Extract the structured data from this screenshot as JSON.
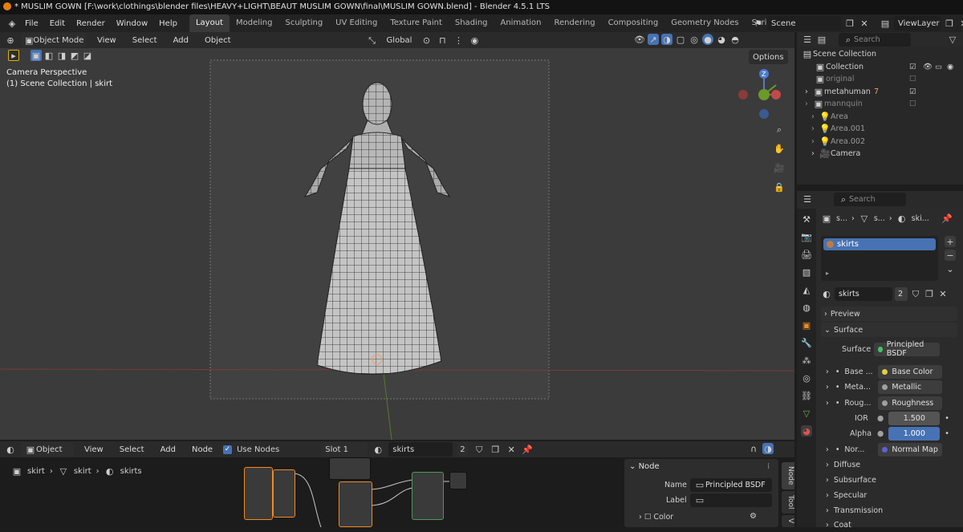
{
  "titlebar": {
    "text": "* MUSLIM GOWN [F:\\work\\clothings\\blender files\\HEAVY+LIGHT\\BEAUT MUSLIM GOWN\\final\\MUSLIM GOWN.blend] - Blender 4.5.1 LTS"
  },
  "menu": [
    "File",
    "Edit",
    "Render",
    "Window",
    "Help"
  ],
  "workspaces": [
    "Layout",
    "Modeling",
    "Sculpting",
    "UV Editing",
    "Texture Paint",
    "Shading",
    "Animation",
    "Rendering",
    "Compositing",
    "Geometry Nodes",
    "Scripting"
  ],
  "scene": {
    "label": "Scene",
    "viewlayer": "ViewLayer"
  },
  "viewport_header": {
    "mode": "Object Mode",
    "menus": [
      "View",
      "Select",
      "Add",
      "Object"
    ],
    "orientation": "Global",
    "options": "Options"
  },
  "viewport": {
    "overlay_line1": "Camera Perspective",
    "overlay_line2": "(1) Scene Collection | skirt"
  },
  "outliner": {
    "search_placeholder": "Search",
    "root": "Scene Collection",
    "items": [
      "Collection",
      "original",
      "metahuman",
      "mannquin",
      "Area",
      "Area.001",
      "Area.002",
      "Camera"
    ],
    "badge": "7"
  },
  "properties": {
    "search_placeholder": "Search",
    "breadcrumb": [
      "s...",
      "s...",
      "ski..."
    ],
    "slot_name": "skirts",
    "material_name": "skirts",
    "users": "2",
    "sections": {
      "preview": "Preview",
      "surface": "Surface"
    },
    "surface_label": "Surface",
    "surface_value": "Principled BSDF",
    "rows": [
      {
        "label": "Base ...",
        "value": "Base Color"
      },
      {
        "label": "Meta...",
        "value": "Metallic"
      },
      {
        "label": "Roug...",
        "value": "Roughness"
      },
      {
        "label": "IOR",
        "value": "1.500"
      },
      {
        "label": "Alpha",
        "value": "1.000"
      },
      {
        "label": "Nor...",
        "value": "Normal Map"
      }
    ],
    "subsections": [
      "Diffuse",
      "Subsurface",
      "Specular",
      "Transmission",
      "Coat"
    ]
  },
  "node_editor": {
    "type": "Object",
    "menus": [
      "View",
      "Select",
      "Add",
      "Node"
    ],
    "use_nodes": "Use Nodes",
    "slot": "Slot 1",
    "material": "skirts",
    "users": "2",
    "breadcrumb": [
      "skirt",
      "skirt",
      "skirts"
    ],
    "sidebar": {
      "title": "Node",
      "name_label": "Name",
      "name_value": "Principled BSDF",
      "label_label": "Label",
      "color_label": "Color",
      "tabs": [
        "Node",
        "Tool",
        "V"
      ]
    }
  },
  "colors": {
    "accent": "#4772b3",
    "active_blue": "#4a7bd0",
    "selected_orange": "#f08a24"
  }
}
